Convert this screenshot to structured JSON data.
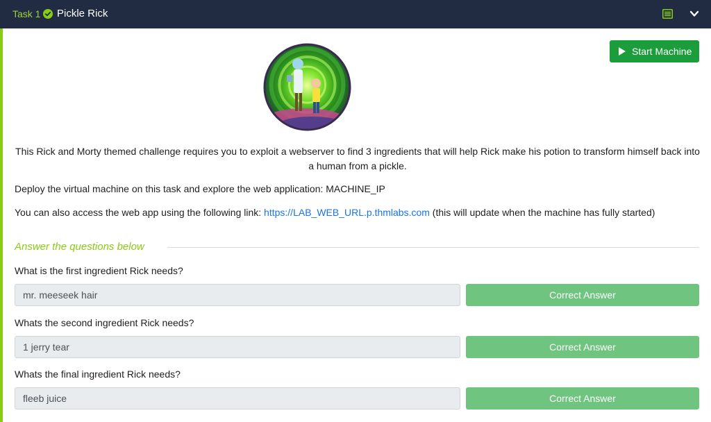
{
  "header": {
    "task_number": "Task 1",
    "task_title": "Pickle Rick"
  },
  "colors": {
    "header_bg": "#212c42",
    "accent_green": "#88cc14",
    "start_button": "#1c9d3c",
    "correct_button": "#6fc47f",
    "link": "#1a73e8"
  },
  "icons": {
    "check": "check-circle-icon",
    "list": "list-icon",
    "chevron": "chevron-down-icon",
    "play": "play-icon"
  },
  "start_machine_label": "Start Machine",
  "description": "This Rick and Morty themed challenge requires you to exploit a webserver to find 3 ingredients that will help Rick make his potion to transform himself back into a human from a pickle.",
  "deploy_text": "Deploy the virtual machine on this task and explore the web application: MACHINE_IP",
  "access": {
    "prefix": "You can also access the web app using the following link: ",
    "link_text": "https://LAB_WEB_URL.p.thmlabs.com",
    "suffix": " (this will update when the machine has fully started)"
  },
  "answer_heading": "Answer the questions below",
  "questions": [
    {
      "question": "What is the first ingredient Rick needs?",
      "answer": "mr. meeseek hair",
      "button": "Correct Answer"
    },
    {
      "question": "Whats the second ingredient Rick needs?",
      "answer": "1 jerry tear",
      "button": "Correct Answer"
    },
    {
      "question": "Whats the final ingredient Rick needs?",
      "answer": "fleeb juice",
      "button": "Correct Answer"
    }
  ]
}
